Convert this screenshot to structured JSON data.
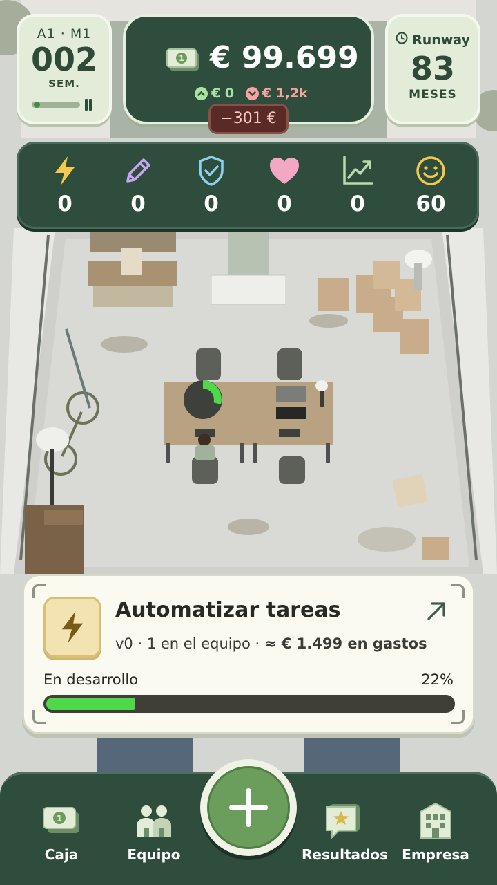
{
  "hud": {
    "period": "A1 · M1",
    "week_number": "002",
    "week_label": "SEM.",
    "week_progress": 0.05,
    "cash_amount": "€ 99.699",
    "income": "€ 0",
    "expenses": "€ 1,2k",
    "cash_delta": "−301 €",
    "runway_title": "Runway",
    "runway_value": "83",
    "runway_unit": "MESES"
  },
  "stats": [
    {
      "icon": "lightning-icon",
      "value": "0",
      "color": "#f2c94c"
    },
    {
      "icon": "pencil-icon",
      "value": "0",
      "color": "#c7a6f0"
    },
    {
      "icon": "shield-check-icon",
      "value": "0",
      "color": "#8fd0ef"
    },
    {
      "icon": "heart-icon",
      "value": "0",
      "color": "#f2a7c3"
    },
    {
      "icon": "growth-chart-icon",
      "value": "0",
      "color": "#b7dca8"
    },
    {
      "icon": "smiley-icon",
      "value": "60",
      "color": "#f5c84a"
    }
  ],
  "task": {
    "title": "Automatizar tareas",
    "version": "v0",
    "team": "1 en el equipo",
    "cost": "≈ € 1.499 en gastos",
    "status": "En desarrollo",
    "progress_label": "22%",
    "progress": 0.22
  },
  "nav": {
    "cash": "Caja",
    "team": "Equipo",
    "results": "Resultados",
    "company": "Empresa"
  },
  "colors": {
    "panel_green": "#2f4d3c",
    "progress_green": "#4fd84a",
    "negative_red": "#5a2a27"
  }
}
